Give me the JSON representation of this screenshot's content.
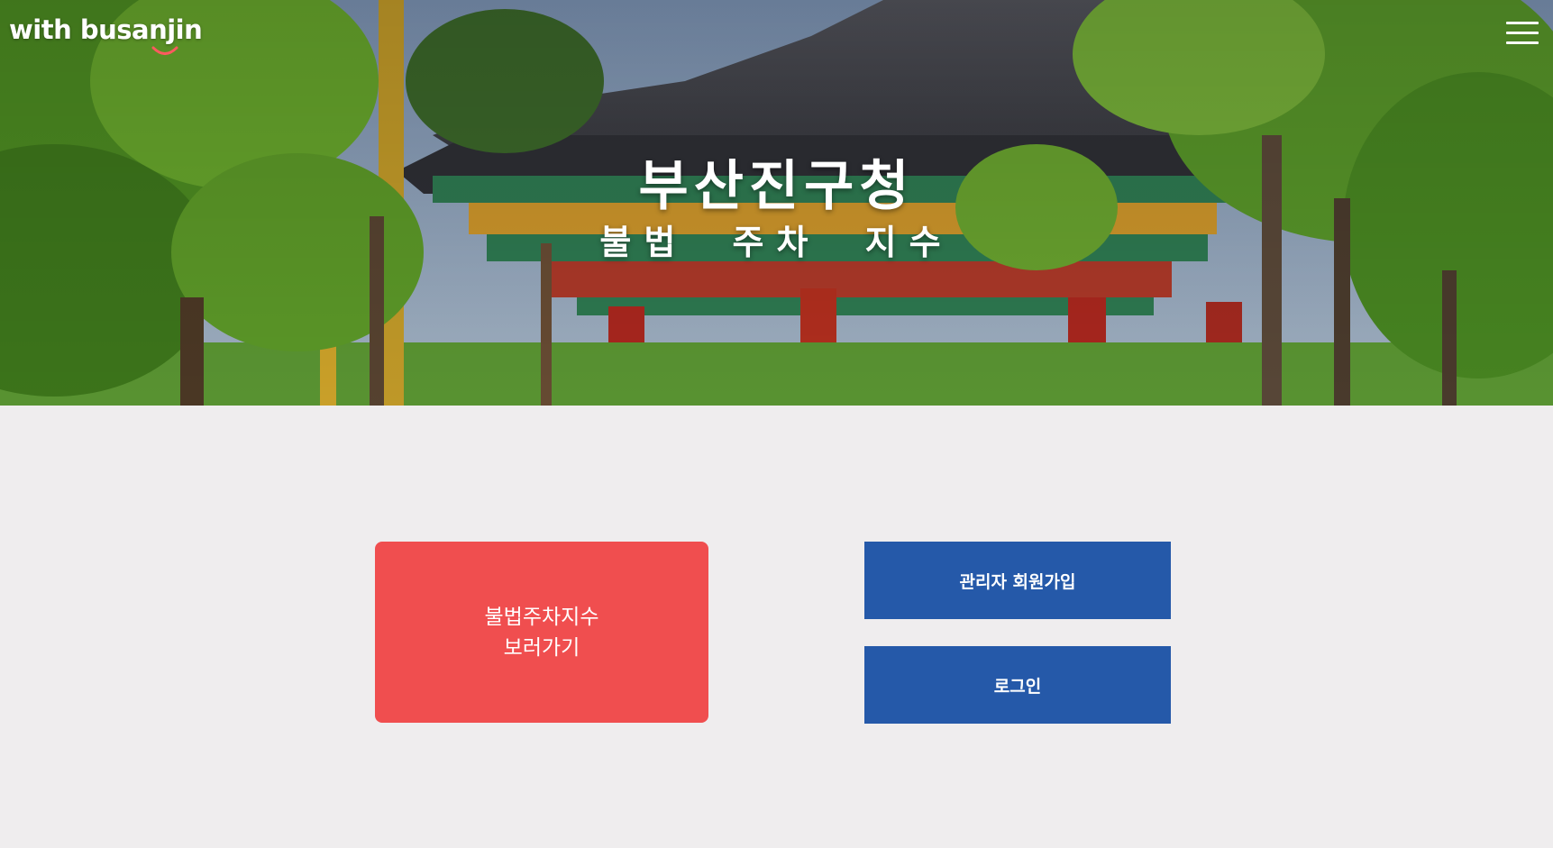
{
  "header": {
    "logo_text": "with busanjin",
    "menu_icon": "hamburger-menu-icon"
  },
  "hero": {
    "title": "부산진구청",
    "subtitle": "불법 주차 지수"
  },
  "actions": {
    "view_index": {
      "line1": "불법주차지수",
      "line2": "보러가기",
      "color": "#f04e4f"
    },
    "admin_signup": {
      "label": "관리자 회원가입",
      "color": "#2559a9"
    },
    "login": {
      "label": "로그인",
      "color": "#2559a9"
    }
  },
  "colors": {
    "page_background": "#efedee",
    "accent_red": "#f04e4f",
    "accent_blue": "#2559a9"
  }
}
